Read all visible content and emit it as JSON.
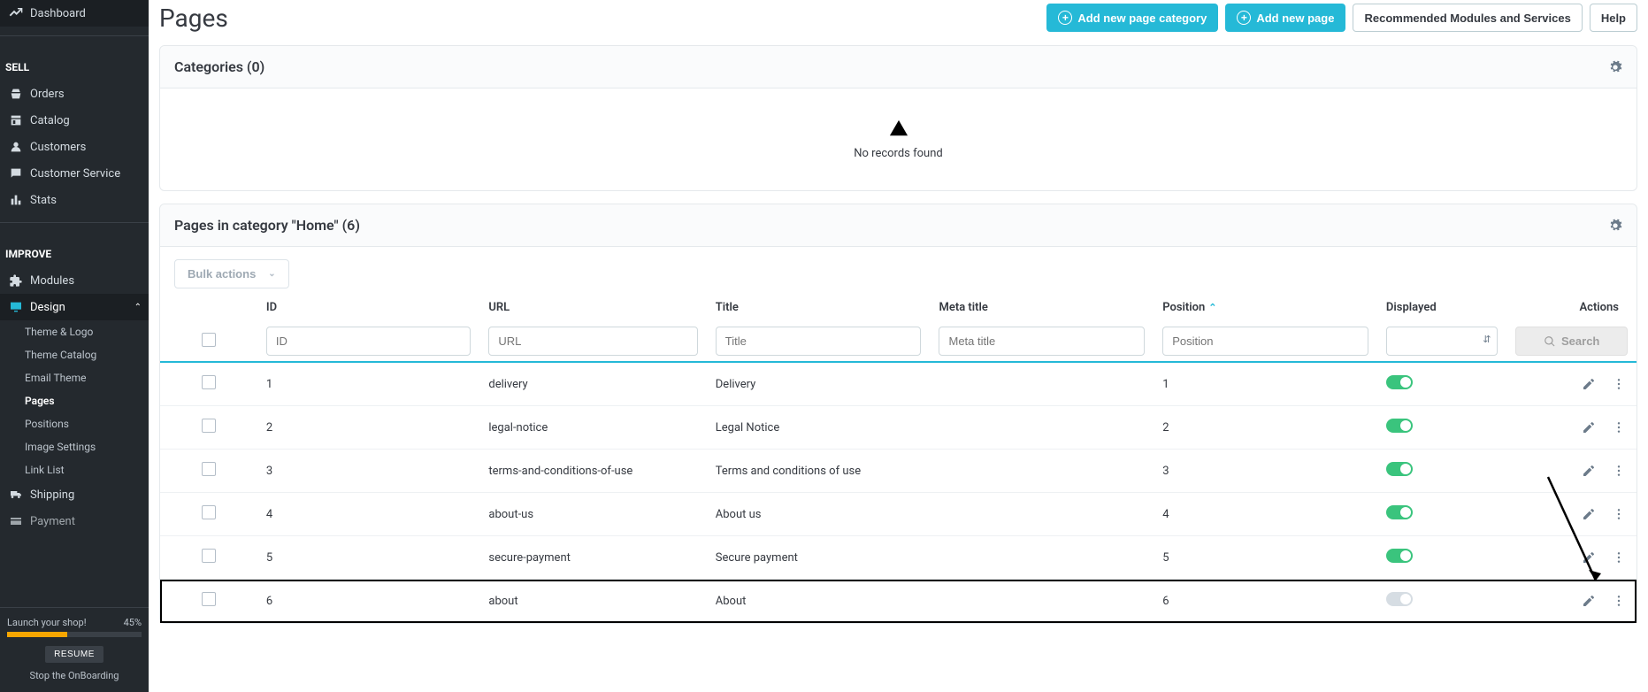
{
  "sidebar": {
    "top": {
      "label": "Dashboard"
    },
    "sell": {
      "title": "SELL",
      "items": [
        {
          "label": "Orders"
        },
        {
          "label": "Catalog"
        },
        {
          "label": "Customers"
        },
        {
          "label": "Customer Service"
        },
        {
          "label": "Stats"
        }
      ]
    },
    "improve": {
      "title": "IMPROVE",
      "items": [
        {
          "label": "Modules"
        },
        {
          "label": "Design"
        },
        {
          "label": "Shipping"
        },
        {
          "label": "Payment"
        }
      ],
      "design_submenu": [
        {
          "label": "Theme & Logo"
        },
        {
          "label": "Theme Catalog"
        },
        {
          "label": "Email Theme"
        },
        {
          "label": "Pages"
        },
        {
          "label": "Positions"
        },
        {
          "label": "Image Settings"
        },
        {
          "label": "Link List"
        }
      ]
    },
    "footer": {
      "launch_label": "Launch your shop!",
      "percent": "45%",
      "resume": "RESUME",
      "stop": "Stop the OnBoarding"
    }
  },
  "header": {
    "title": "Pages",
    "add_category": "Add new page category",
    "add_page": "Add new page",
    "recommended": "Recommended Modules and Services",
    "help": "Help"
  },
  "categories_panel": {
    "title": "Categories (0)",
    "empty": "No records found"
  },
  "pages_panel": {
    "title": "Pages in category \"Home\" (6)",
    "bulk": "Bulk actions",
    "columns": {
      "id": "ID",
      "url": "URL",
      "title": "Title",
      "meta": "Meta title",
      "position": "Position",
      "displayed": "Displayed",
      "actions": "Actions"
    },
    "filters": {
      "id_ph": "ID",
      "url_ph": "URL",
      "title_ph": "Title",
      "meta_ph": "Meta title",
      "pos_ph": "Position",
      "search": "Search"
    },
    "rows": [
      {
        "id": "1",
        "url": "delivery",
        "title": "Delivery",
        "position": "1",
        "displayed": true
      },
      {
        "id": "2",
        "url": "legal-notice",
        "title": "Legal Notice",
        "position": "2",
        "displayed": true
      },
      {
        "id": "3",
        "url": "terms-and-conditions-of-use",
        "title": "Terms and conditions of use",
        "position": "3",
        "displayed": true
      },
      {
        "id": "4",
        "url": "about-us",
        "title": "About us",
        "position": "4",
        "displayed": true
      },
      {
        "id": "5",
        "url": "secure-payment",
        "title": "Secure payment",
        "position": "5",
        "displayed": true
      },
      {
        "id": "6",
        "url": "about",
        "title": "About",
        "position": "6",
        "displayed": false
      }
    ]
  }
}
